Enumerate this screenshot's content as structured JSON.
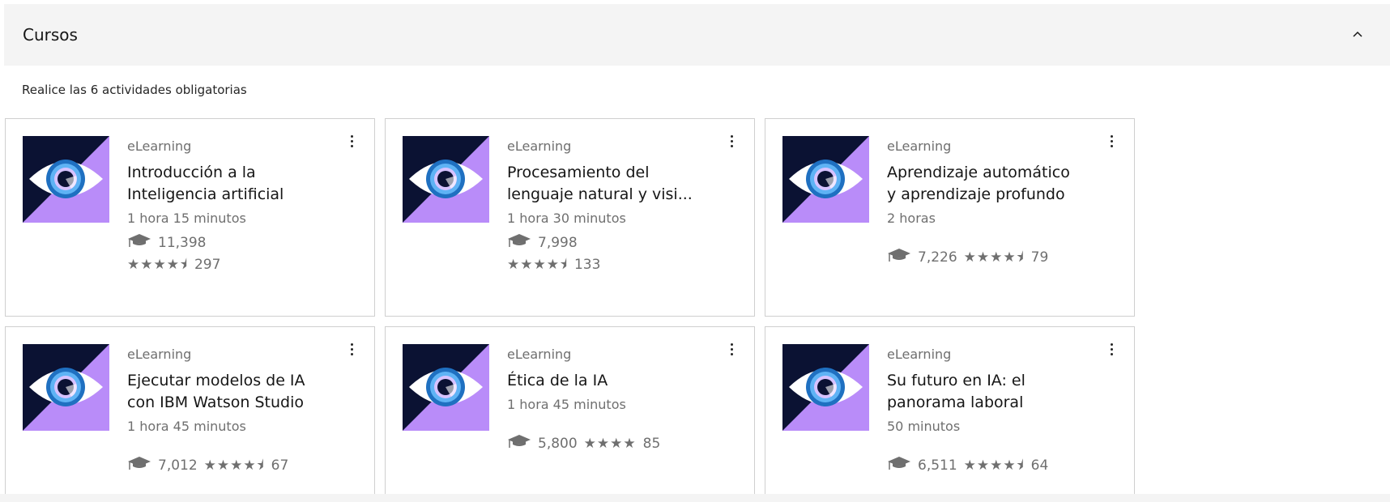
{
  "section": {
    "title": "Cursos",
    "subtitle": "Realice las 6 actividades obligatorias"
  },
  "cards": [
    {
      "kind": "eLearning",
      "title_line1": "Introducción a la",
      "title_line2": "Inteligencia artificial",
      "duration": "1 hora 15 minutos",
      "learners": "11,398",
      "reviews": "297",
      "stars": "★★★★⯨"
    },
    {
      "kind": "eLearning",
      "title_line1": "Procesamiento del",
      "title_line2": "lenguaje natural y visi...",
      "duration": "1 hora 30 minutos",
      "learners": "7,998",
      "reviews": "133",
      "stars": "★★★★⯨"
    },
    {
      "kind": "eLearning",
      "title_line1": "Aprendizaje automático",
      "title_line2": "y aprendizaje profundo",
      "duration": "2 horas",
      "learners": "7,226",
      "reviews": "79",
      "stars": "★★★★⯨"
    },
    {
      "kind": "eLearning",
      "title_line1": "Ejecutar modelos de IA",
      "title_line2": "con IBM Watson Studio",
      "duration": "1 hora 45 minutos",
      "learners": "7,012",
      "reviews": "67",
      "stars": "★★★★⯨"
    },
    {
      "kind": "eLearning",
      "title_line1": "Ética de la IA",
      "title_line2": "",
      "duration": "1 hora 45 minutos",
      "learners": "5,800",
      "reviews": "85",
      "stars": "★★★★"
    },
    {
      "kind": "eLearning",
      "title_line1": "Su futuro en IA: el",
      "title_line2": "panorama laboral",
      "duration": "50 minutos",
      "learners": "6,511",
      "reviews": "64",
      "stars": "★★★★⯨"
    }
  ],
  "icons": {
    "collapse": "chevron-up-icon",
    "menu": "overflow-menu-icon",
    "learners": "graduation-cap-icon",
    "rating": "star-icon",
    "thumbnail": "eye-logo-icon"
  },
  "colors": {
    "thumb_dark": "#0b1233",
    "thumb_purple": "#b98cf9",
    "thumb_blue": "#1f70c1",
    "thumb_light_blue": "#5fb3f5"
  }
}
